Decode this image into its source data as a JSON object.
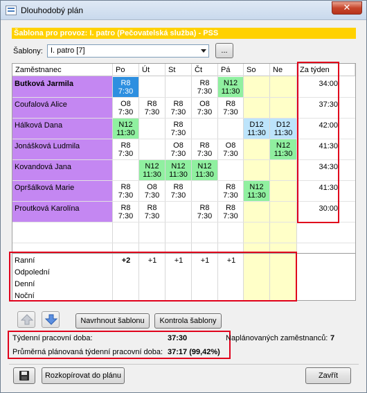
{
  "window": {
    "title": "Dlouhodobý plán",
    "close_symbol": "✕"
  },
  "banner": {
    "text": "Šablona pro provoz: I. patro (Pečovatelská služba) - PSS",
    "color": "#ffd100"
  },
  "template_selector": {
    "label": "Šablony:",
    "value": "I. patro [7]",
    "browse_label": "..."
  },
  "grid": {
    "headers": {
      "employee": "Zaměstnanec",
      "days": [
        "Po",
        "Út",
        "St",
        "Čt",
        "Pá",
        "So",
        "Ne"
      ],
      "week_total": "Za týden"
    },
    "rows": [
      {
        "name": "Butková Jarmila",
        "total": "34:00"
      },
      {
        "name": "Coufalová Alice",
        "total": "37:30"
      },
      {
        "name": "Hálková Dana",
        "total": "42:00"
      },
      {
        "name": "Jonášková Ludmila",
        "total": "41:30"
      },
      {
        "name": "Kovandová Jana",
        "total": "34:30"
      },
      {
        "name": "Opršálková Marie",
        "total": "41:30"
      },
      {
        "name": "Proutková Karolína",
        "total": "30:00"
      }
    ],
    "shifts": [
      {
        "row": 0,
        "day": 0,
        "code": "R8",
        "time": "7:30",
        "color": "blue"
      },
      {
        "row": 0,
        "day": 3,
        "code": "R8",
        "time": "7:30",
        "color": "none"
      },
      {
        "row": 0,
        "day": 4,
        "code": "N12",
        "time": "11:30",
        "color": "green"
      },
      {
        "row": 1,
        "day": 0,
        "code": "O8",
        "time": "7:30",
        "color": "none"
      },
      {
        "row": 1,
        "day": 1,
        "code": "R8",
        "time": "7:30",
        "color": "none"
      },
      {
        "row": 1,
        "day": 2,
        "code": "R8",
        "time": "7:30",
        "color": "none"
      },
      {
        "row": 1,
        "day": 3,
        "code": "O8",
        "time": "7:30",
        "color": "none"
      },
      {
        "row": 1,
        "day": 4,
        "code": "R8",
        "time": "7:30",
        "color": "none"
      },
      {
        "row": 2,
        "day": 0,
        "code": "N12",
        "time": "11:30",
        "color": "green"
      },
      {
        "row": 2,
        "day": 2,
        "code": "R8",
        "time": "7:30",
        "color": "none"
      },
      {
        "row": 2,
        "day": 5,
        "code": "D12",
        "time": "11:30",
        "color": "lightblue"
      },
      {
        "row": 2,
        "day": 6,
        "code": "D12",
        "time": "11:30",
        "color": "lightblue"
      },
      {
        "row": 3,
        "day": 0,
        "code": "R8",
        "time": "7:30",
        "color": "none"
      },
      {
        "row": 3,
        "day": 2,
        "code": "O8",
        "time": "7:30",
        "color": "none"
      },
      {
        "row": 3,
        "day": 3,
        "code": "R8",
        "time": "7:30",
        "color": "none"
      },
      {
        "row": 3,
        "day": 4,
        "code": "O8",
        "time": "7:30",
        "color": "none"
      },
      {
        "row": 3,
        "day": 6,
        "code": "N12",
        "time": "11:30",
        "color": "green"
      },
      {
        "row": 4,
        "day": 1,
        "code": "N12",
        "time": "11:30",
        "color": "green"
      },
      {
        "row": 4,
        "day": 2,
        "code": "N12",
        "time": "11:30",
        "color": "green"
      },
      {
        "row": 4,
        "day": 3,
        "code": "N12",
        "time": "11:30",
        "color": "green"
      },
      {
        "row": 5,
        "day": 0,
        "code": "R8",
        "time": "7:30",
        "color": "none"
      },
      {
        "row": 5,
        "day": 1,
        "code": "O8",
        "time": "7:30",
        "color": "none"
      },
      {
        "row": 5,
        "day": 2,
        "code": "R8",
        "time": "7:30",
        "color": "none"
      },
      {
        "row": 5,
        "day": 4,
        "code": "R8",
        "time": "7:30",
        "color": "none"
      },
      {
        "row": 5,
        "day": 5,
        "code": "N12",
        "time": "11:30",
        "color": "green"
      },
      {
        "row": 6,
        "day": 0,
        "code": "R8",
        "time": "7:30",
        "color": "none"
      },
      {
        "row": 6,
        "day": 1,
        "code": "R8",
        "time": "7:30",
        "color": "none"
      },
      {
        "row": 6,
        "day": 3,
        "code": "R8",
        "time": "7:30",
        "color": "none"
      },
      {
        "row": 6,
        "day": 4,
        "code": "R8",
        "time": "7:30",
        "color": "none"
      }
    ],
    "summary": {
      "labels": [
        "Ranní",
        "Odpolední",
        "Denní",
        "Noční"
      ],
      "ranni_values": [
        "+2",
        "+1",
        "+1",
        "+1",
        "+1",
        "",
        ""
      ]
    },
    "colors": {
      "name_bg": "#c487f2",
      "weekend_bg": "#ffffc8",
      "green": "#90f0a0",
      "blue": "#2d8fe0",
      "lightblue": "#bde4fb",
      "highlight": "#e0001b"
    }
  },
  "actions": {
    "propose": "Navrhnout šablonu",
    "check": "Kontrola šablony"
  },
  "stats": {
    "weekly_label": "Týdenní pracovní doba:",
    "weekly_value": "37:30",
    "planned_label": "Naplánovaných zaměstnanců:",
    "planned_value": "7",
    "avg_label": "Průměrná plánovaná týdenní pracovní doba:",
    "avg_value": "37:17 (99,42%)"
  },
  "footer": {
    "copy_label": "Rozkopírovat do plánu",
    "close_label": "Zavřít"
  }
}
